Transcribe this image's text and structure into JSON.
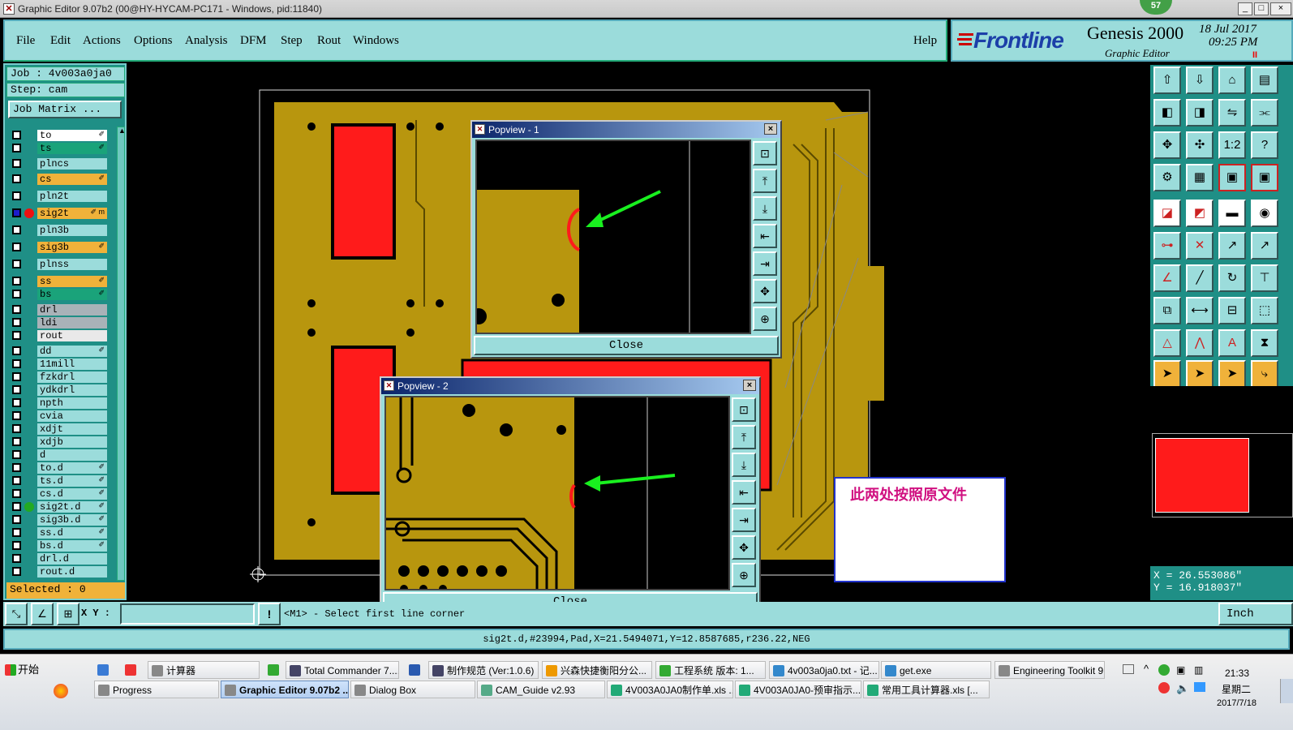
{
  "window": {
    "title": "Graphic Editor 9.07b2 (00@HY-HYCAM-PC171 - Windows, pid:11840)",
    "badge": "57",
    "min_label": "_",
    "max_label": "□",
    "close_label": "×"
  },
  "menu": {
    "items": [
      "File",
      "Edit",
      "Actions",
      "Options",
      "Analysis",
      "DFM",
      "Step",
      "Rout",
      "Windows"
    ],
    "help": "Help"
  },
  "brand": {
    "logo": "Frontline",
    "product": "Genesis 2000",
    "subtitle": "Graphic Editor",
    "date": "18 Jul 2017",
    "time": "09:25 PM",
    "pause": "II"
  },
  "job": {
    "job_label": "Job : 4v003a0ja0",
    "step_label": "Step: cam",
    "matrix_button": "Job Matrix ..."
  },
  "layers": [
    {
      "name": "to",
      "color": "#ffffff",
      "edit": "✐"
    },
    {
      "name": "ts",
      "color": "#1aa37a",
      "edit": "✐"
    },
    {
      "name": "plncs",
      "color": "#9bdcdb",
      "edit": ""
    },
    {
      "name": "cs",
      "color": "#f0b23a",
      "edit": "✐"
    },
    {
      "name": "pln2t",
      "color": "#9bdcdb",
      "edit": ""
    },
    {
      "name": "sig2t",
      "color": "#f0b23a",
      "edit": "✐ m",
      "active": true
    },
    {
      "name": "pln3b",
      "color": "#9bdcdb",
      "edit": ""
    },
    {
      "name": "sig3b",
      "color": "#f0b23a",
      "edit": "✐"
    },
    {
      "name": "plnss",
      "color": "#9bdcdb",
      "edit": ""
    },
    {
      "name": "ss",
      "color": "#f0b23a",
      "edit": "✐"
    },
    {
      "name": "bs",
      "color": "#1aa37a",
      "edit": "✐"
    },
    {
      "name": "drl",
      "color": "#a9b2b8",
      "edit": ""
    },
    {
      "name": "ldi",
      "color": "#a9b2b8",
      "edit": ""
    },
    {
      "name": "rout",
      "color": "#e9e9e9",
      "edit": ""
    },
    {
      "name": "dd",
      "color": "#9bdcdb",
      "edit": "✐"
    },
    {
      "name": "11mill",
      "color": "#9bdcdb",
      "edit": ""
    },
    {
      "name": "fzkdrl",
      "color": "#9bdcdb",
      "edit": ""
    },
    {
      "name": "ydkdrl",
      "color": "#9bdcdb",
      "edit": ""
    },
    {
      "name": "npth",
      "color": "#9bdcdb",
      "edit": ""
    },
    {
      "name": "cvia",
      "color": "#9bdcdb",
      "edit": ""
    },
    {
      "name": "xdjt",
      "color": "#9bdcdb",
      "edit": ""
    },
    {
      "name": "xdjb",
      "color": "#9bdcdb",
      "edit": ""
    },
    {
      "name": "d",
      "color": "#9bdcdb",
      "edit": ""
    },
    {
      "name": "to.d",
      "color": "#9bdcdb",
      "edit": "✐"
    },
    {
      "name": "ts.d",
      "color": "#9bdcdb",
      "edit": "✐"
    },
    {
      "name": "cs.d",
      "color": "#9bdcdb",
      "edit": "✐"
    },
    {
      "name": "sig2t.d",
      "color": "#9bdcdb",
      "edit": "✐",
      "marker": true
    },
    {
      "name": "sig3b.d",
      "color": "#9bdcdb",
      "edit": "✐"
    },
    {
      "name": "ss.d",
      "color": "#9bdcdb",
      "edit": "✐"
    },
    {
      "name": "bs.d",
      "color": "#9bdcdb",
      "edit": "✐"
    },
    {
      "name": "drl.d",
      "color": "#9bdcdb",
      "edit": ""
    },
    {
      "name": "rout.d",
      "color": "#9bdcdb",
      "edit": ""
    }
  ],
  "selected": "Selected : 0",
  "popview1": {
    "title": "Popview - 1",
    "close": "Close"
  },
  "popview2": {
    "title": "Popview - 2",
    "close": "Close"
  },
  "annotation": "此两处按照原文件",
  "coords": {
    "x": "X = 26.553086\"",
    "y": "Y = 16.918037\""
  },
  "command": {
    "xy_label": "X Y :",
    "xy_value": "",
    "message": "<M1> - Select first line corner",
    "unit": "Inch"
  },
  "status": "sig2t.d,#23994,Pad,X=21.5494071,Y=12.8587685,r236.22,NEG",
  "taskbar": {
    "start": "开始",
    "row1": [
      "",
      "",
      "计算器",
      "",
      "Total Commander 7....",
      "",
      "制作规范 (Ver:1.0.6)",
      "兴森快捷衡阳分公...",
      "工程系统  版本: 1...",
      "4v003a0ja0.txt - 记...",
      "get.exe",
      "Engineering Toolkit 9..."
    ],
    "row2": [
      "Progress",
      "Graphic Editor 9.07b2 ...",
      "Dialog Box",
      "CAM_Guide v2.93",
      "4V003A0JA0制作单.xls ...",
      "4V003A0JA0-预审指示....",
      "常用工具计算器.xls [..."
    ],
    "clock": "21:33",
    "weekday": "星期二",
    "date": "2017/7/18"
  },
  "colors": {
    "panel": "#9bdcdb",
    "panel_dark": "#1f8f86",
    "board": "#b8960e",
    "pad_red": "#ff1b1b",
    "arrow": "#19f01f"
  },
  "icons": {
    "popup_side": [
      "popview-zoom-icon",
      "popview-up-icon",
      "popview-down-icon",
      "popview-left-icon",
      "popview-right-icon",
      "popview-fit-icon",
      "popview-center-icon"
    ]
  }
}
